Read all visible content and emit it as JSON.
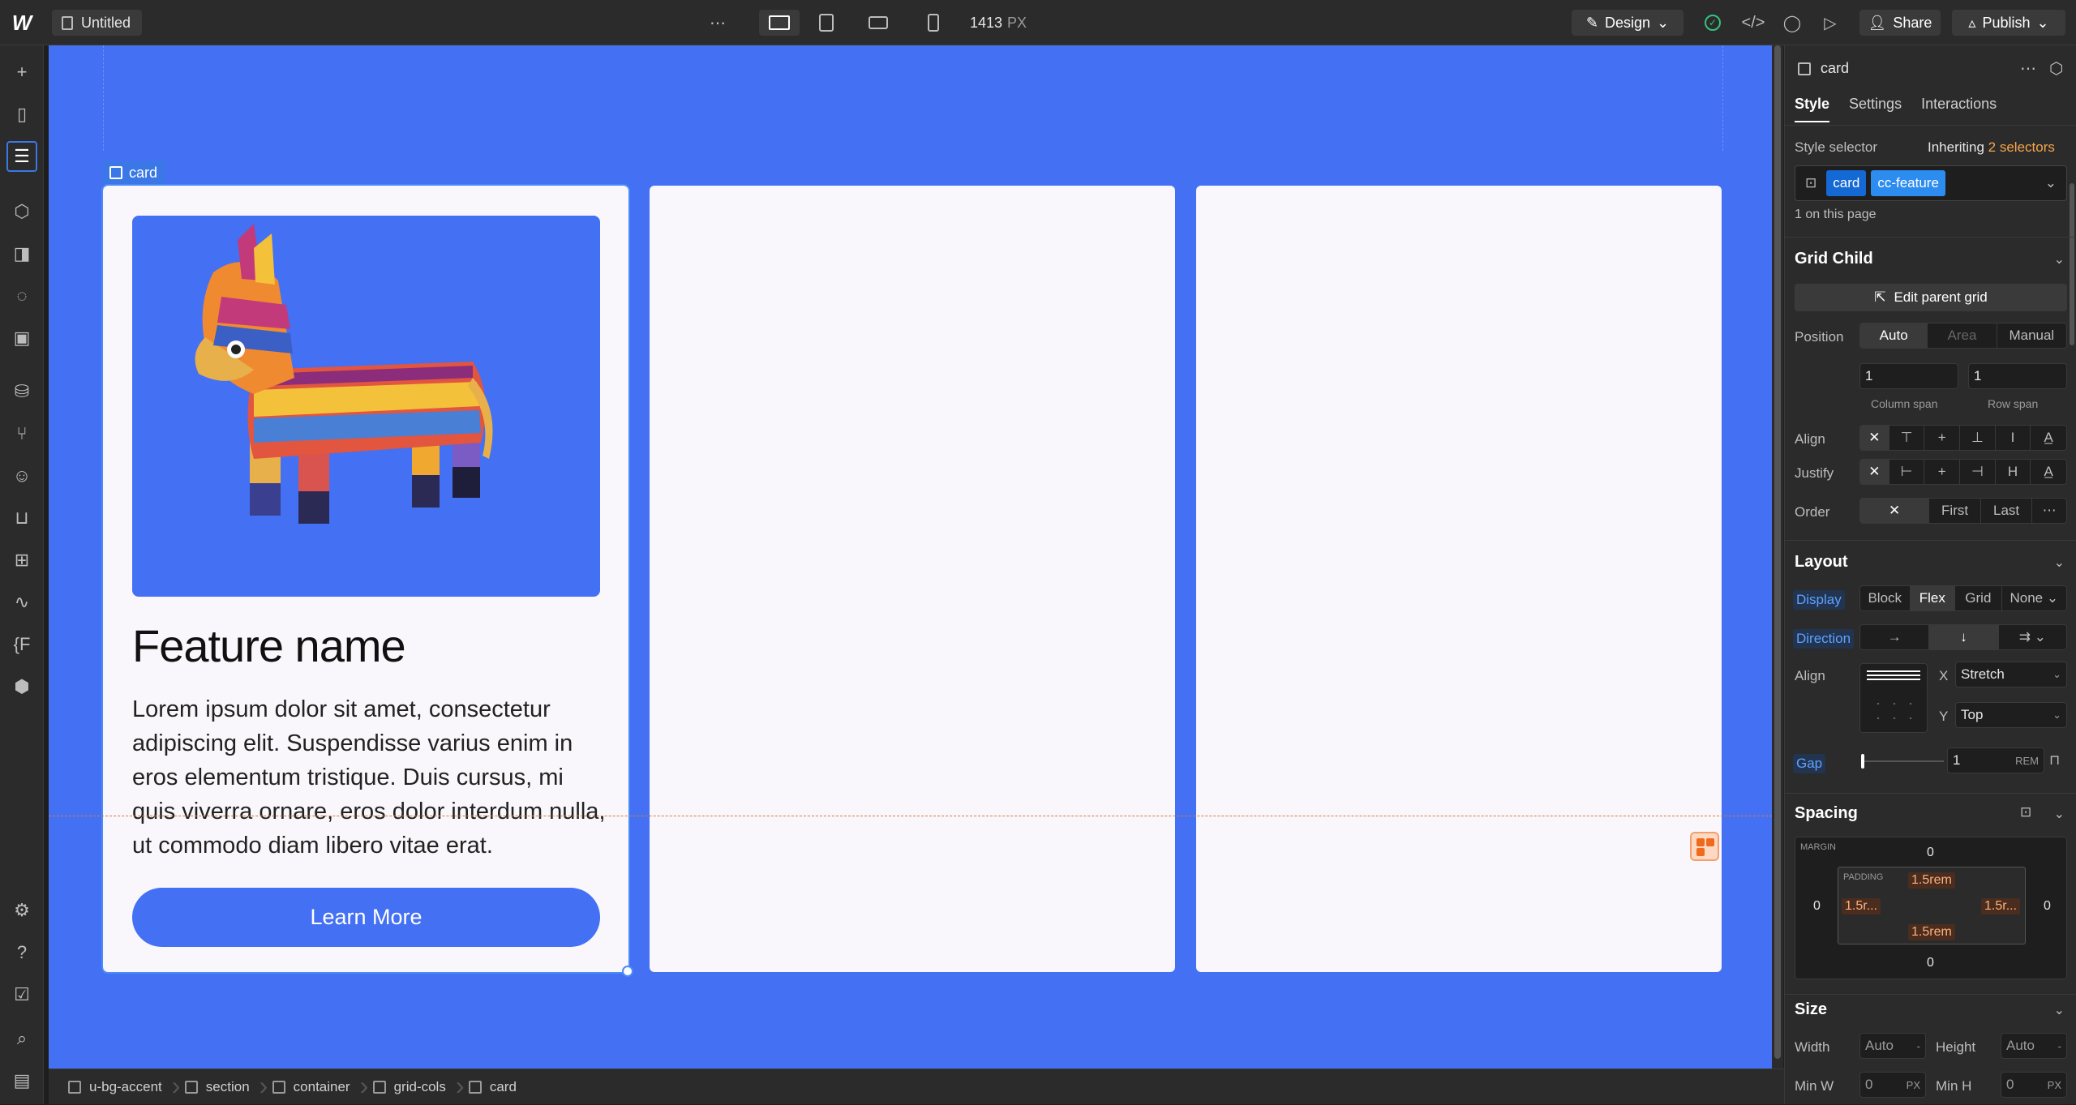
{
  "topbar": {
    "doc_name": "Untitled",
    "width_value": "1413",
    "width_unit": "PX",
    "mode_label": "Design",
    "share_label": "Share",
    "publish_label": "Publish"
  },
  "canvas": {
    "selected_label": "card",
    "card": {
      "title": "Feature name",
      "body": "Lorem ipsum dolor sit amet, consectetur adipiscing elit. Suspendisse varius enim in eros elementum tristique. Duis cursus, mi quis viverra ornare, eros dolor interdum nulla, ut commodo diam libero vitae erat.",
      "button": "Learn More"
    }
  },
  "breadcrumb": [
    "u-bg-accent",
    "section",
    "container",
    "grid-cols",
    "card"
  ],
  "panel": {
    "element_name": "card",
    "tabs": [
      "Style",
      "Settings",
      "Interactions"
    ],
    "style_selector_label": "Style selector",
    "inheriting_label": "Inheriting",
    "inheriting_count": "2 selectors",
    "chips": [
      "card",
      "cc-feature"
    ],
    "on_page": "1 on this page",
    "grid_child": {
      "heading": "Grid Child",
      "edit_parent": "Edit parent grid",
      "position_label": "Position",
      "position_options": [
        "Auto",
        "Area",
        "Manual"
      ],
      "column_span_value": "1",
      "row_span_value": "1",
      "column_span_label": "Column span",
      "row_span_label": "Row span",
      "align_label": "Align",
      "justify_label": "Justify",
      "order_label": "Order",
      "order_options": [
        "First",
        "Last"
      ]
    },
    "layout": {
      "heading": "Layout",
      "display_label": "Display",
      "display_options": [
        "Block",
        "Flex",
        "Grid",
        "None"
      ],
      "direction_label": "Direction",
      "align_label": "Align",
      "x_label": "X",
      "x_value": "Stretch",
      "y_label": "Y",
      "y_value": "Top",
      "gap_label": "Gap",
      "gap_value": "1",
      "gap_unit": "REM"
    },
    "spacing": {
      "heading": "Spacing",
      "margin_label": "MARGIN",
      "padding_label": "PADDING",
      "margin_top": "0",
      "margin_bottom": "0",
      "margin_left": "0",
      "margin_right": "0",
      "padding_top": "1.5rem",
      "padding_bottom": "1.5rem",
      "padding_left": "1.5r...",
      "padding_right": "1.5r..."
    },
    "size": {
      "heading": "Size",
      "width_label": "Width",
      "width_value": "Auto",
      "height_label": "Height",
      "height_value": "Auto",
      "minw_label": "Min W",
      "minw_value": "0",
      "minh_label": "Min H",
      "minh_value": "0",
      "unit": "PX"
    }
  },
  "colors": {
    "canvas_bg": "#4470f4",
    "accent": "#3b78e7",
    "card_bg": "#f9f7fb"
  }
}
